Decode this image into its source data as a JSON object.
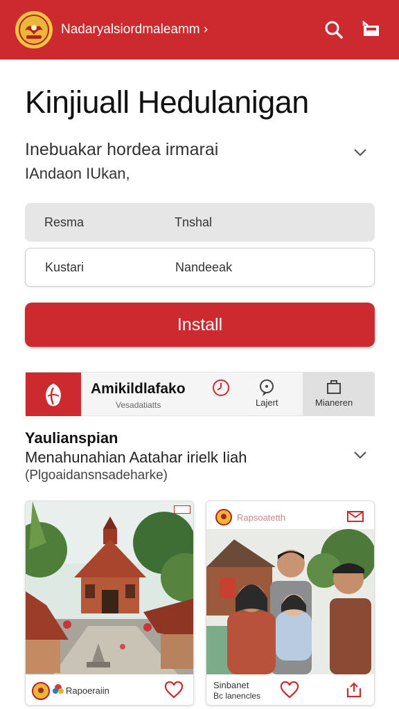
{
  "header": {
    "app_title": "Nadaryalsiordmaleamm ›",
    "icons": [
      "emblem-logo",
      "search-icon",
      "bag-icon"
    ]
  },
  "hero": {
    "title": "Kinjiuall Hedulanigan",
    "subtitle": "Inebuakar hordea irmarai",
    "subtitle2": "IAndaon IUkan,"
  },
  "fields": [
    {
      "label": "Resma",
      "value": "Tnshal"
    },
    {
      "label": "Kustari",
      "value": "Nandeeak"
    }
  ],
  "install_label": "Install",
  "app_row": {
    "name": "Amikildlafako",
    "sub": "Vesadatiatts",
    "actions": [
      {
        "label": "",
        "icon": "clock-icon"
      },
      {
        "label": "Lajert",
        "icon": "chat-icon"
      },
      {
        "label": "Mianeren",
        "icon": "box-icon"
      }
    ]
  },
  "section": {
    "title": "Yaulianspian",
    "line": "Menahunahian Aatahar irielk Iiah",
    "note": "(Plgoaidansnsadeharke)"
  },
  "cards": [
    {
      "badge": "",
      "brand": "Rapoeraiin",
      "footer_left": "",
      "footer_sub": ""
    },
    {
      "badge": "Rapsoatetth",
      "brand": "",
      "footer_left": "Sinbanet",
      "footer_sub": "Bc lanencles"
    }
  ],
  "colors": {
    "brand_red": "#cc2a2e",
    "gold": "#f3c544"
  }
}
